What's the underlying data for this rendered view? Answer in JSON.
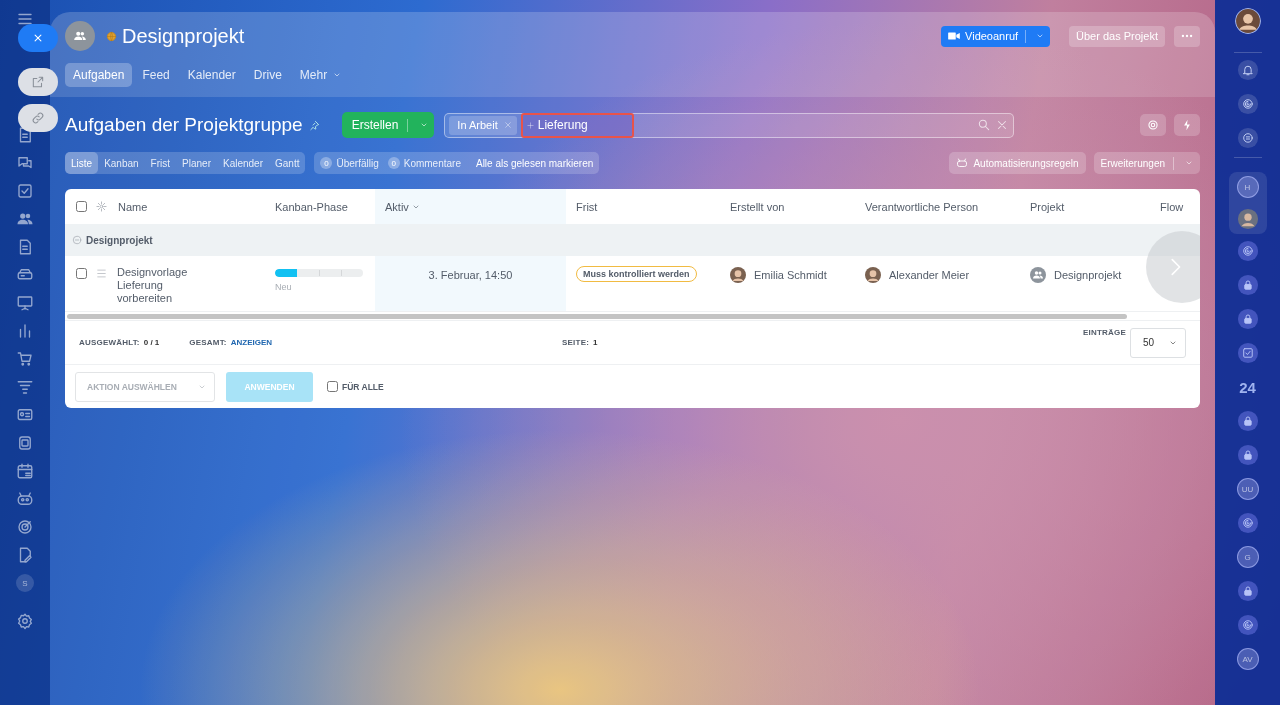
{
  "header": {
    "title": "Designprojekt",
    "video_button": "Videoanruf",
    "about_button": "Über das Projekt",
    "tabs": [
      {
        "label": "Aufgaben",
        "selected": true
      },
      {
        "label": "Feed",
        "selected": false
      },
      {
        "label": "Kalender",
        "selected": false
      },
      {
        "label": "Drive",
        "selected": false
      },
      {
        "label": "Mehr",
        "selected": false,
        "dropdown": true
      }
    ]
  },
  "toolbar": {
    "title": "Aufgaben der Projektgruppe",
    "create_button": "Erstellen",
    "filter": {
      "tags": [
        {
          "label": "In Arbeit"
        }
      ],
      "value": "Lieferung",
      "highlighted": true
    },
    "view_tabs": [
      {
        "label": "Liste",
        "selected": true
      },
      {
        "label": "Kanban",
        "selected": false
      },
      {
        "label": "Frist",
        "selected": false
      },
      {
        "label": "Planer",
        "selected": false
      },
      {
        "label": "Kalender",
        "selected": false
      },
      {
        "label": "Gantt",
        "selected": false
      }
    ],
    "counters": [
      {
        "count": "0",
        "label": "Überfällig"
      },
      {
        "count": "0",
        "label": "Kommentare"
      }
    ],
    "mark_read": "Alle als gelesen markieren",
    "automation_button": "Automatisierungsregeln",
    "extensions_button": "Erweiterungen"
  },
  "table": {
    "columns": [
      {
        "label": "Name",
        "sorted": false
      },
      {
        "label": "Kanban-Phase",
        "sorted": false
      },
      {
        "label": "Aktiv",
        "sorted": true
      },
      {
        "label": "Frist",
        "sorted": false
      },
      {
        "label": "Erstellt von",
        "sorted": false
      },
      {
        "label": "Verantwortliche Person",
        "sorted": false
      },
      {
        "label": "Projekt",
        "sorted": false
      },
      {
        "label": "Flow",
        "sorted": false
      }
    ],
    "group": {
      "label": "Designprojekt",
      "expanded": true
    },
    "rows": [
      {
        "checked": false,
        "name": "Designvorlage Lieferung vorbereiten",
        "stage": "Neu",
        "level": 0.25,
        "active": "3. Februar, 14:50",
        "deadline": "Muss kontrolliert werden",
        "creator": "Emilia Schmidt",
        "responsible": "Alexander Meier",
        "project": "Designprojekt"
      }
    ]
  },
  "footer": {
    "selected_label": "AUSGEWÄHLT:",
    "selected_value": "0 / 1",
    "total_label": "GESAMT:",
    "total_link": "ANZEIGEN",
    "page_label": "SEITE:",
    "page_value": "1",
    "entries_label": "EINTRÄGE",
    "entries_value": "50",
    "action_placeholder": "AKTION AUSWÄHLEN",
    "apply_button": "ANWENDEN",
    "apply_disabled": true,
    "for_all_label": "FÜR ALLE",
    "for_all_checked": false
  },
  "left_sidebar": {
    "avatar_letter": "S"
  },
  "right_sidebar": {
    "letters": [
      "H",
      "UU",
      "G",
      "AV"
    ],
    "counter": "24"
  }
}
